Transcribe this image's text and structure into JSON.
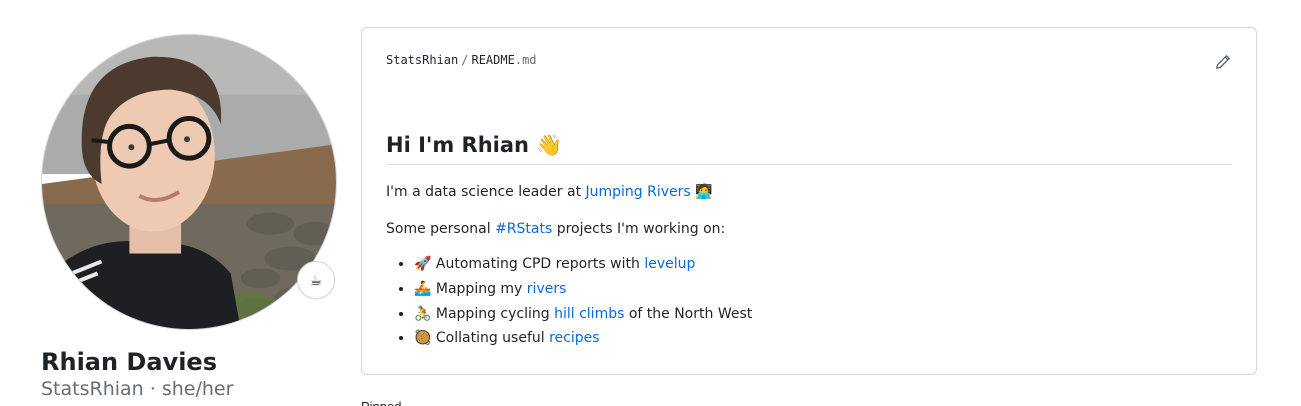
{
  "profile": {
    "full_name": "Rhian Davies",
    "username": "StatsRhian",
    "pronouns_line": "StatsRhian · she/her",
    "status_emoji": "☕"
  },
  "readme": {
    "owner": "StatsRhian",
    "separator": "/",
    "file_base": "README",
    "file_ext": ".md",
    "heading": "Hi I'm Rhian 👋",
    "intro_text": "I'm a data science leader at ",
    "intro_link": "Jumping Rivers",
    "intro_emoji": " 🧑‍💻",
    "projects_pre": "Some personal ",
    "projects_link": "#RStats",
    "projects_post": " projects I'm working on:",
    "items": [
      {
        "emoji": "🚀",
        "text": " Automating CPD reports with ",
        "link": "levelup",
        "after": ""
      },
      {
        "emoji": "🚣",
        "text": " Mapping my ",
        "link": "rivers",
        "after": ""
      },
      {
        "emoji": "🚴",
        "text": " Mapping cycling ",
        "link": "hill climbs",
        "after": " of the North West"
      },
      {
        "emoji": "🥘",
        "text": " Collating useful ",
        "link": "recipes",
        "after": ""
      }
    ]
  },
  "below_text": "Pinned",
  "colors": {
    "link": "#0969da",
    "border": "#d0d7de",
    "muted": "#656d76"
  }
}
